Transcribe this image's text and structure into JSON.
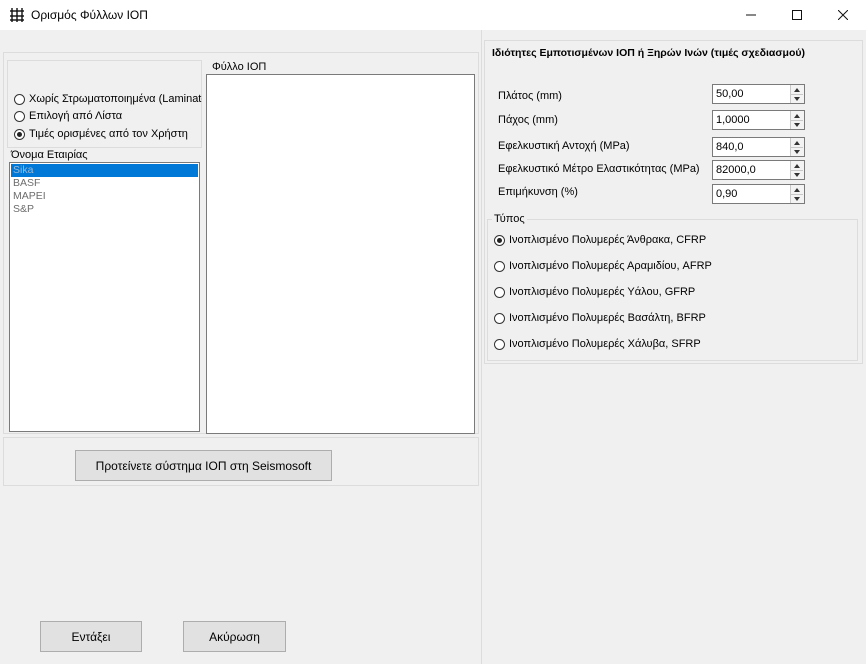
{
  "window": {
    "title": "Ορισμός Φύλλων ΙΟΠ"
  },
  "left": {
    "options": [
      {
        "label": "Χωρίς Στρωματοποιημένα (Laminate",
        "checked": false
      },
      {
        "label": "Επιλογή από Λίστα",
        "checked": false
      },
      {
        "label": "Τιμές ορισμένες από τον Χρήστη",
        "checked": true
      }
    ],
    "company_label": "Όνομα Εταιρίας",
    "companies": [
      "Sika",
      "BASF",
      "MAPEI",
      "S&P"
    ],
    "sheet_label": "Φύλλο ΙΟΠ",
    "propose_button": "Προτείνετε σύστημα ΙΟΠ στη Seismosoft"
  },
  "right": {
    "header": "Ιδιότητες Εμποτισμένων ΙΟΠ ή Ξηρών Ινών (τιμές σχεδιασμού)",
    "fields": [
      {
        "label": "Πλάτος (mm)",
        "value": "50,00"
      },
      {
        "label": "Πάχος (mm)",
        "value": "1,0000"
      },
      {
        "label": "Εφελκυστική Αντοχή (MPa)",
        "value": "840,0"
      },
      {
        "label": "Εφελκυστικό Μέτρο Ελαστικότητας (MPa)",
        "value": "82000,0"
      },
      {
        "label": "Επιμήκυνση (%)",
        "value": "0,90"
      }
    ],
    "type_label": "Τύπος",
    "types": [
      {
        "label": "Ινοπλισμένο Πολυμερές Άνθρακα, CFRP",
        "checked": true
      },
      {
        "label": "Ινοπλισμένο Πολυμερές Αραμιδίου, AFRP",
        "checked": false
      },
      {
        "label": "Ινοπλισμένο Πολυμερές Υάλου, GFRP",
        "checked": false
      },
      {
        "label": "Ινοπλισμένο Πολυμερές Βασάλτη, BFRP",
        "checked": false
      },
      {
        "label": "Ινοπλισμένο Πολυμερές Χάλυβα, SFRP",
        "checked": false
      }
    ]
  },
  "buttons": {
    "ok": "Εντάξει",
    "cancel": "Ακύρωση"
  }
}
